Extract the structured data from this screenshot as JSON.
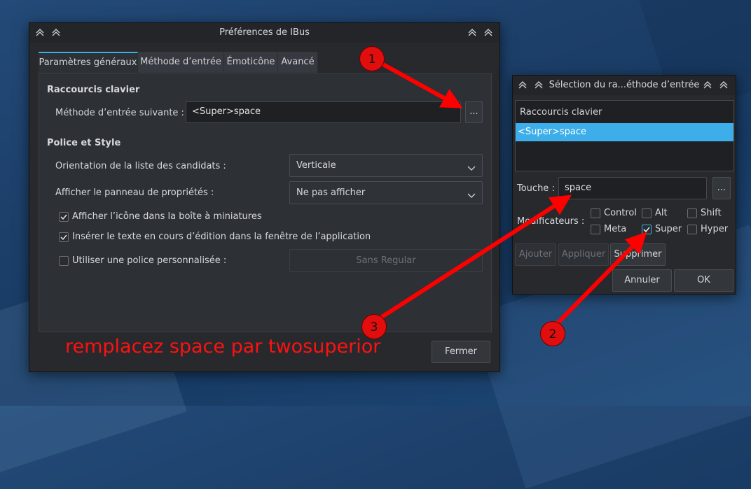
{
  "main_window": {
    "title": "Préférences de IBus",
    "tabs": [
      {
        "label": "Paramètres généraux",
        "active": true
      },
      {
        "label": "Méthode d’entrée",
        "active": false
      },
      {
        "label": "Émoticône",
        "active": false
      },
      {
        "label": "Avancé",
        "active": false
      }
    ],
    "shortcuts_section": "Raccourcis clavier",
    "next_method_label": "Méthode d’entrée suivante :",
    "next_method_value": "<Super>space",
    "next_method_button": "...",
    "font_section": "Police et Style",
    "orientation_label": "Orientation de la liste des candidats :",
    "orientation_value": "Verticale",
    "panel_label": "Afficher le panneau de propriétés :",
    "panel_value": "Ne pas afficher",
    "checkbox_systray": {
      "label": "Afficher l’icône dans la boîte à miniatures",
      "checked": true
    },
    "checkbox_embed": {
      "label": "Insérer le texte en cours d’édition dans la fenêtre de l’application",
      "checked": true
    },
    "checkbox_font": {
      "label": "Utiliser une police personnalisée :",
      "checked": false
    },
    "font_value": "Sans Regular",
    "close_button": "Fermer"
  },
  "dialog": {
    "title": "Sélection du ra...éthode d’entrée",
    "list_header": "Raccourcis clavier",
    "list_items": [
      "<Super>space"
    ],
    "key_label": "Touche :",
    "key_value": "space",
    "key_button": "...",
    "modifiers_label": "Modificateurs :",
    "modifiers": [
      {
        "label": "Control",
        "checked": false
      },
      {
        "label": "Alt",
        "checked": false
      },
      {
        "label": "Shift",
        "checked": false
      },
      {
        "label": "Meta",
        "checked": false
      },
      {
        "label": "Super",
        "checked": true
      },
      {
        "label": "Hyper",
        "checked": false
      }
    ],
    "add_button": "Ajouter",
    "apply_button": "Appliquer",
    "delete_button": "Supprimer",
    "cancel_button": "Annuler",
    "ok_button": "OK"
  },
  "annotations": {
    "step1": "1",
    "step2": "2",
    "step3": "3",
    "instruction": "remplacez space par twosuperior",
    "color": "#ff0000"
  },
  "colors": {
    "accent": "#3daee9",
    "window_bg": "#27292d"
  }
}
